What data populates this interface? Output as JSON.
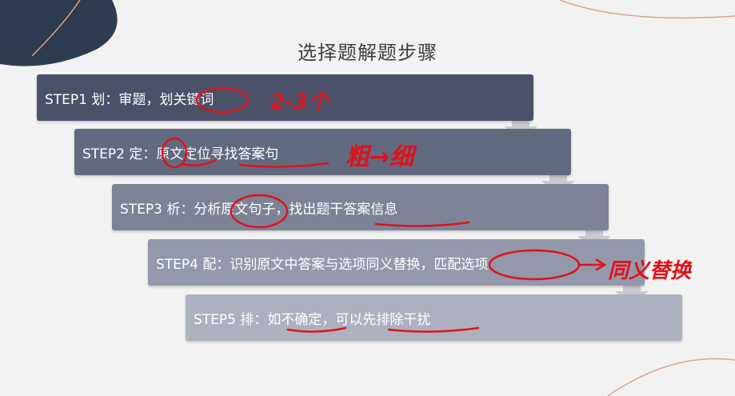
{
  "slide": {
    "title": "选择题解题步骤"
  },
  "steps": [
    {
      "label": "STEP1 划：审题，划关键词"
    },
    {
      "label": "STEP2 定：原文定位寻找答案句"
    },
    {
      "label": "STEP3 析：分析原文句子，找出题干答案信息"
    },
    {
      "label": "STEP4 配：识别原文中答案与选项同义替换，匹配选项"
    },
    {
      "label": "STEP5 排：如不确定，可以先排除干扰"
    }
  ],
  "colors": {
    "step_colors": [
      "#4a5168",
      "#626a80",
      "#7c8397",
      "#9398aa",
      "#adb1bf"
    ],
    "arrow": "#c9c9cf",
    "ink": "#e0121b",
    "background": "#f2f2f2"
  },
  "annotations": {
    "step1_note": "2-3个",
    "step2_note": "粗→细",
    "step4_note": "同义替换"
  }
}
